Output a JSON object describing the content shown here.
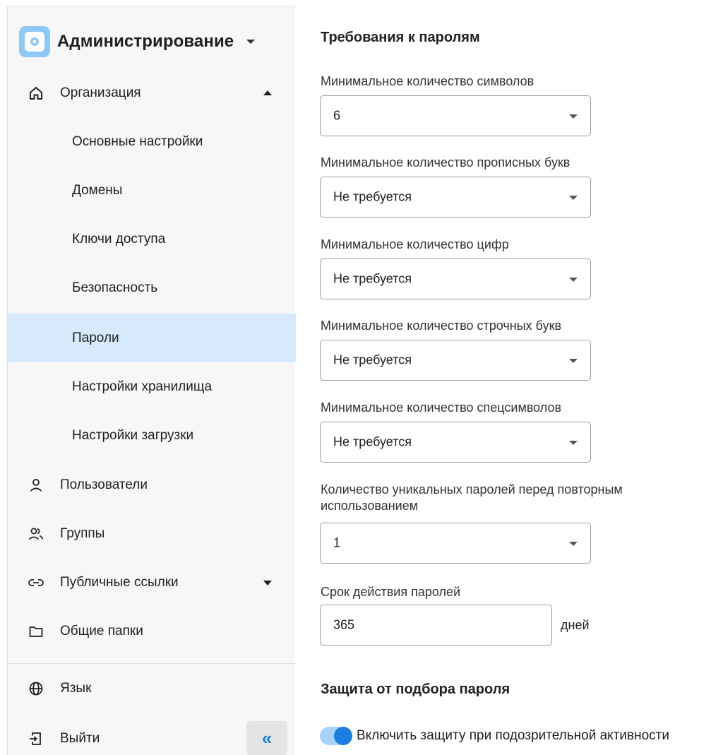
{
  "app": {
    "title": "Администрирование"
  },
  "sidebar": {
    "org": {
      "label": "Организация"
    },
    "subitems": [
      {
        "label": "Основные настройки"
      },
      {
        "label": "Домены"
      },
      {
        "label": "Ключи доступа"
      },
      {
        "label": "Безопасность"
      },
      {
        "label": "Пароли"
      },
      {
        "label": "Настройки хранилища"
      },
      {
        "label": "Настройки загрузки"
      }
    ],
    "users": {
      "label": "Пользователи"
    },
    "groups": {
      "label": "Группы"
    },
    "links": {
      "label": "Публичные ссылки"
    },
    "folders": {
      "label": "Общие папки"
    },
    "language": {
      "label": "Язык"
    },
    "logout": {
      "label": "Выйти"
    },
    "collapse": {
      "label": "«"
    }
  },
  "main": {
    "section_title": "Требования к паролям",
    "fields": [
      {
        "label": "Минимальное количество символов",
        "value": "6"
      },
      {
        "label": "Минимальное количество прописных букв",
        "value": "Не требуется"
      },
      {
        "label": "Минимальное количество цифр",
        "value": "Не требуется"
      },
      {
        "label": "Минимальное количество строчных букв",
        "value": "Не требуется"
      },
      {
        "label": "Минимальное количество спецсимволов",
        "value": "Не требуется"
      }
    ],
    "unique": {
      "label_line1": "Количество уникальных паролей перед повторным",
      "label_line2": "использованием",
      "value": "1"
    },
    "expiry": {
      "label": "Срок действия паролей",
      "value": "365",
      "unit": "дней"
    },
    "protection": {
      "title": "Защита от подбора пароля",
      "toggle_label": "Включить защиту при подозрительной активности",
      "toggle_on": true
    }
  },
  "colors": {
    "accent": "#1a7fe0",
    "active_bg": "#d6eafb",
    "toggle_track": "#a8d2fa"
  }
}
